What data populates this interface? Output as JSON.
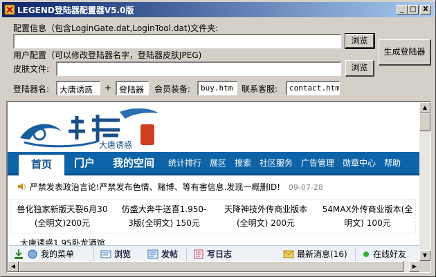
{
  "window": {
    "title": "LEGEND登陆器配置器V5.0版",
    "min_glyph": "_",
    "max_glyph": "□",
    "close_glyph": "X"
  },
  "form": {
    "config_info_label": "配置信息（包含LoginGate.dat,LoginTool.dat)文件夹:",
    "config_path_value": "",
    "browse_label_1": "浏览",
    "generate_label": "生成登陆器",
    "user_config_label": "用户配置（可以修改登陆器名字，登陆器皮肤JPEG)",
    "skin_file_label": "皮肤文件:",
    "skin_file_value": "",
    "browse_label_2": "浏览",
    "launcher_name_label": "登陆器名:",
    "launcher_name_value": "大唐诱惑",
    "plus": "+",
    "launcher_suffix_value": "登陆器",
    "member_equip_label": "会员装备:",
    "member_equip_value": "buy.htm",
    "contact_label": "联系客服:",
    "contact_value": "contact.htm"
  },
  "browser": {
    "logo_text": "大唐诱惑",
    "nav": {
      "active": "首页",
      "big": [
        "门户",
        "我的空间"
      ],
      "small": [
        "统计排行",
        "展区",
        "搜索",
        "社区服务",
        "广告管理",
        "勋章中心",
        "帮助"
      ]
    },
    "notice_text": "严禁发表政治言论!严禁发布色情、赌博、等有害信息.发现一概删ID!",
    "notice_date": "09-07-28",
    "cards": [
      {
        "line1": "兽化独家新版天裂6月30",
        "line2": "(全明文)200元"
      },
      {
        "line1": "仿盛大奔牛送喜1.950-",
        "line2": "3版(全明文) 150元"
      },
      {
        "line1": "天降神技外传商业版本",
        "line2": "(全明文) 200元"
      },
      {
        "line1": "54MAX外传商业版本(全",
        "line2": "明文) 100元"
      }
    ],
    "partial_text": "大唐诱惑1.95卧龙酒馆"
  },
  "bottombar": {
    "menu": "我的菜单",
    "browse": "浏览",
    "post": "发帖",
    "diary": "写日志",
    "news": "最新消息(16)",
    "online": "在线好友"
  }
}
